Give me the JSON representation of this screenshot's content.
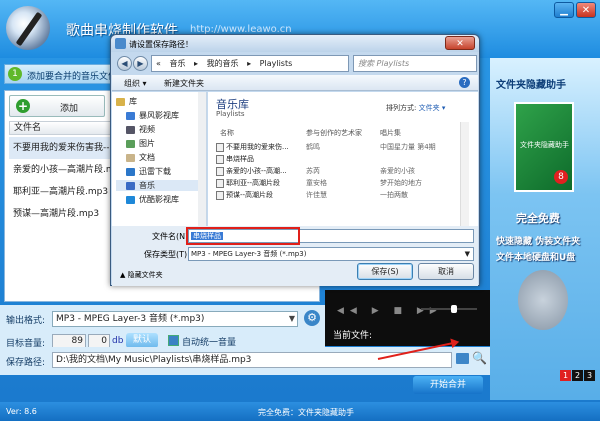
{
  "app": {
    "title": "歌曲串烧制作软件",
    "url": "http://www.leawo.cn",
    "step_number": "1",
    "step_text": "添加要合并的音乐文件",
    "add_label": "添加",
    "list_header": "文件名",
    "files": [
      "不要用我的爱来伤害我--",
      "亲爱的小孩—高潮片段.mp3",
      "耶利亚—高潮片段.mp3",
      "预谋—高潮片段.mp3"
    ],
    "output_format_label": "输出格式:",
    "output_format_value": "MP3 - MPEG Layer-3 音频 (*.mp3)",
    "target_volume_label": "目标音量:",
    "volume_1": "89",
    "volume_2": "0",
    "db": "db",
    "default_btn": "默认",
    "auto_volume_label": "自动统一音量",
    "save_path_label": "保存路径:",
    "save_path_value": "D:\\我的文档\\My Music\\Playlists\\串烧样品.mp3",
    "merge_btn": "开始合并",
    "current_file_label": "当前文件:",
    "version": "Ver: 8.6",
    "status_center": "完全免费：文件夹隐藏助手",
    "window_min": "▁",
    "window_close": "✕",
    "player_controls": "◀◀ ▶ ■ ▶▶"
  },
  "ad": {
    "title": "文件夹隐藏助手",
    "box_text": "文件夹隐藏助手",
    "box_badge": "8",
    "free": "完全免费",
    "line1": "快速隐藏 伪装文件夹",
    "line2": "文件本地硬盘和U盘",
    "pages": [
      "1",
      "2",
      "3"
    ]
  },
  "dialog": {
    "title": "请设置保存路径！",
    "close": "✕",
    "back": "◀",
    "forward": "▶",
    "breadcrumb": [
      "«",
      "音乐",
      "▸",
      "我的音乐",
      "▸",
      "Playlists"
    ],
    "search_placeholder": "搜索 Playlists",
    "toolbar_organize": "组织 ▾",
    "toolbar_newfolder": "新建文件夹",
    "help": "?",
    "nav_items": [
      "库",
      "暴风影视库",
      "视频",
      "图片",
      "文档",
      "迅雷下载",
      "音乐",
      "优酷影视库"
    ],
    "library_title": "音乐库",
    "library_sub": "Playlists",
    "arrange_label": "排列方式:",
    "arrange_value": "文件夹 ▾",
    "columns": [
      "名称",
      "参与创作的艺术家",
      "唱片集"
    ],
    "rows": [
      {
        "name": "不要用我的爱来伤...",
        "artist": "鹤鸣",
        "album": "中国星力量 第4期"
      },
      {
        "name": "串烧样品",
        "artist": "",
        "album": ""
      },
      {
        "name": "亲爱的小孩--高潮...",
        "artist": "苏芮",
        "album": "亲爱的小孩"
      },
      {
        "name": "耶利亚--高潮片段",
        "artist": "童安格",
        "album": "梦开始的地方"
      },
      {
        "name": "预谋--高潮片段",
        "artist": "许佳慧",
        "album": "一拍两散"
      }
    ],
    "filename_label": "文件名(N):",
    "filename_value": "串烧样品",
    "filetype_label": "保存类型(T):",
    "filetype_value": "MP3 - MPEG Layer-3 音频 (*.mp3)",
    "hide_folders": "▲ 隐藏文件夹",
    "save_btn": "保存(S)",
    "cancel_btn": "取消"
  }
}
